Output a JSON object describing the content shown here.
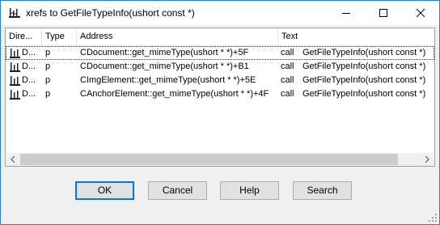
{
  "window": {
    "title": "xrefs to GetFileTypeInfo(ushort const *)",
    "icon": "xref-icon"
  },
  "list": {
    "columns": [
      "Dire...",
      "Type",
      "Address",
      "Text"
    ],
    "rows": [
      {
        "direction": "D...",
        "type": "p",
        "address": "CDocument::get_mimeType(ushort * *)+5F",
        "text_op": "call",
        "text_arg": "GetFileTypeInfo(ushort const *)"
      },
      {
        "direction": "D...",
        "type": "p",
        "address": "CDocument::get_mimeType(ushort * *)+B1",
        "text_op": "call",
        "text_arg": "GetFileTypeInfo(ushort const *)"
      },
      {
        "direction": "D...",
        "type": "p",
        "address": "CImgElement::get_mimeType(ushort * *)+5E",
        "text_op": "call",
        "text_arg": "GetFileTypeInfo(ushort const *)"
      },
      {
        "direction": "D...",
        "type": "p",
        "address": "CAnchorElement::get_mimeType(ushort * *)+4F",
        "text_op": "call",
        "text_arg": "GetFileTypeInfo(ushort const *)"
      }
    ]
  },
  "buttons": {
    "ok": "OK",
    "cancel": "Cancel",
    "help": "Help",
    "search": "Search"
  },
  "colors": {
    "accent": "#0078d7",
    "window_border": "#2a7fd4"
  }
}
